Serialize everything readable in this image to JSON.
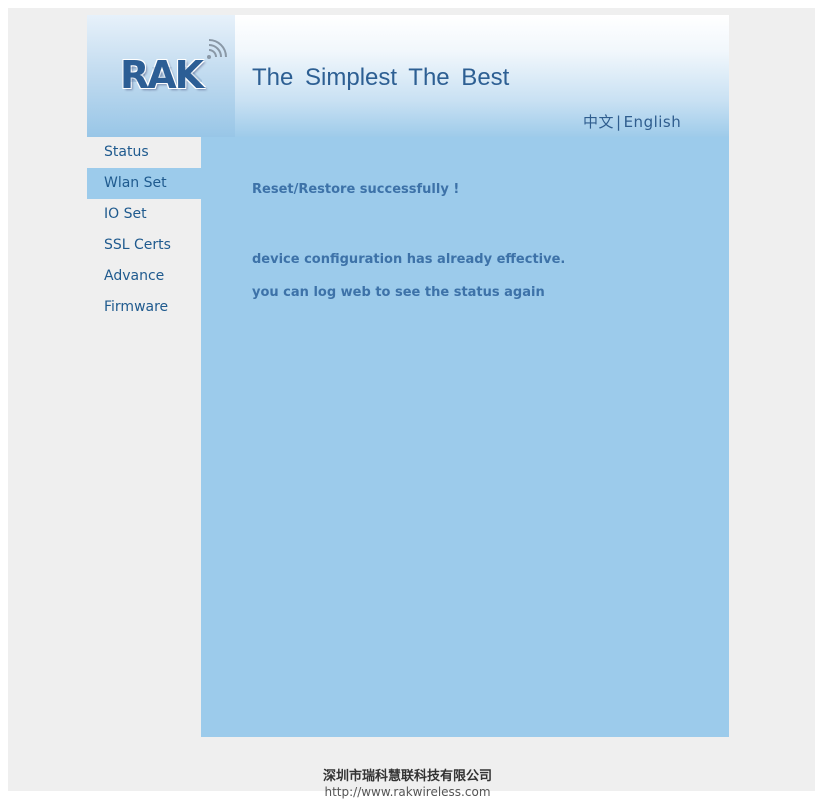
{
  "header": {
    "logo_text": "RAK",
    "tagline": "The  Simplest  The  Best",
    "lang_chinese": "中文",
    "lang_separator": "|",
    "lang_english": "English"
  },
  "sidebar": {
    "items": [
      {
        "label": "Status"
      },
      {
        "label": "Wlan Set",
        "active": true
      },
      {
        "label": "IO Set"
      },
      {
        "label": "SSL Certs"
      },
      {
        "label": "Advance"
      },
      {
        "label": "Firmware"
      }
    ]
  },
  "content": {
    "title": "Reset/Restore successfully !",
    "line1": "device configuration has already effective.",
    "line2": "you can log web to see the status again"
  },
  "footer": {
    "company": "深圳市瑞科慧联科技有限公司",
    "url": "http://www.rakwireless.com"
  },
  "colors": {
    "accent": "#9ccbeb",
    "text_blue": "#1f5a8e"
  }
}
